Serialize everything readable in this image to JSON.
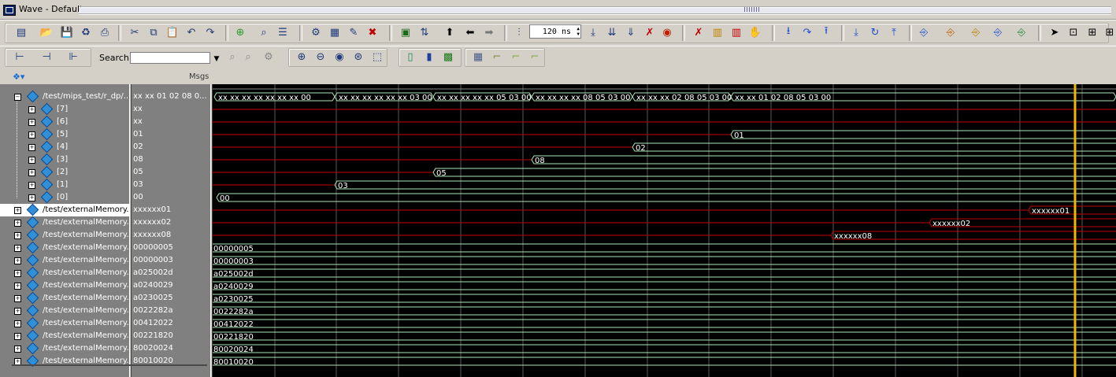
{
  "window": {
    "title": "Wave - Default"
  },
  "toolbar1": {
    "time_step_value": "120 ns",
    "buttons": [
      "new-icon",
      "open-icon",
      "save-icon",
      "reload-icon",
      "print-icon",
      "cut-icon",
      "copy-icon",
      "paste-icon",
      "undo-icon",
      "redo-icon",
      "add-icon",
      "find-icon",
      "format-icon",
      "compile-icon",
      "simulate-icon",
      "break-icon",
      "stop-icon",
      "restart-icon",
      "step-icon",
      "up-icon",
      "back-icon",
      "forward-icon",
      "run-icon",
      "run-all-icon",
      "continue-icon",
      "step-over-icon",
      "step-into-icon",
      "step-out-icon",
      "zoom-icon",
      "cursor-icon"
    ]
  },
  "toolbar2": {
    "search_label": "Search:",
    "search_value": ""
  },
  "header": {
    "msgs_label": "Msgs"
  },
  "signals": [
    {
      "name": "/test/mips_test/r_dp/...",
      "value": "xx xx 01 02 08 0...",
      "expanded": true,
      "level": 0
    },
    {
      "name": "[7]",
      "value": "xx",
      "level": 1
    },
    {
      "name": "[6]",
      "value": "xx",
      "level": 1
    },
    {
      "name": "[5]",
      "value": "01",
      "level": 1
    },
    {
      "name": "[4]",
      "value": "02",
      "level": 1
    },
    {
      "name": "[3]",
      "value": "08",
      "level": 1
    },
    {
      "name": "[2]",
      "value": "05",
      "level": 1
    },
    {
      "name": "[1]",
      "value": "03",
      "level": 1
    },
    {
      "name": "[0]",
      "value": "00",
      "level": 1
    },
    {
      "name": "/test/externalMemory...",
      "value": "xxxxxx01",
      "level": 0,
      "selected": true
    },
    {
      "name": "/test/externalMemory...",
      "value": "xxxxxx02",
      "level": 0
    },
    {
      "name": "/test/externalMemory...",
      "value": "xxxxxx08",
      "level": 0
    },
    {
      "name": "/test/externalMemory...",
      "value": "00000005",
      "level": 0
    },
    {
      "name": "/test/externalMemory...",
      "value": "00000003",
      "level": 0
    },
    {
      "name": "/test/externalMemory...",
      "value": "a025002d",
      "level": 0
    },
    {
      "name": "/test/externalMemory...",
      "value": "a0240029",
      "level": 0
    },
    {
      "name": "/test/externalMemory...",
      "value": "a0230025",
      "level": 0
    },
    {
      "name": "/test/externalMemory...",
      "value": "0022282a",
      "level": 0
    },
    {
      "name": "/test/externalMemory...",
      "value": "00412022",
      "level": 0
    },
    {
      "name": "/test/externalMemory...",
      "value": "00221820",
      "level": 0
    },
    {
      "name": "/test/externalMemory...",
      "value": "80020024",
      "level": 0
    },
    {
      "name": "/test/externalMemory...",
      "value": "80010020",
      "level": 0
    }
  ],
  "wave_labels": {
    "bus_segments": [
      "xx xx xx xx xx xx xx 00",
      "xx xx xx xx xx xx 03 00",
      "xx xx xx xx xx 05 03 00",
      "xx xx xx xx 08 05 03 00",
      "xx xx xx 02 08 05 03 00",
      "xx xx 01 02 08 05 03 00"
    ],
    "bit5": "01",
    "bit4": "02",
    "bit3": "08",
    "bit2": "05",
    "bit1": "03",
    "bit0": "00",
    "mem0": "xxxxxx01",
    "mem1": "xxxxxx02",
    "mem2": "xxxxxx08",
    "mem3": "00000005",
    "mem4": "00000003",
    "mem5": "a025002d",
    "mem6": "a0240029",
    "mem7": "a0230025",
    "mem8": "0022282a",
    "mem9": "00412022",
    "mem10": "00221820",
    "mem11": "80020024",
    "mem12": "80010020"
  },
  "colors": {
    "wave_x": "#c00000",
    "wave_valid": "#aee6b8",
    "cursor": "#f0b800",
    "grid": "#5a5a5a"
  }
}
